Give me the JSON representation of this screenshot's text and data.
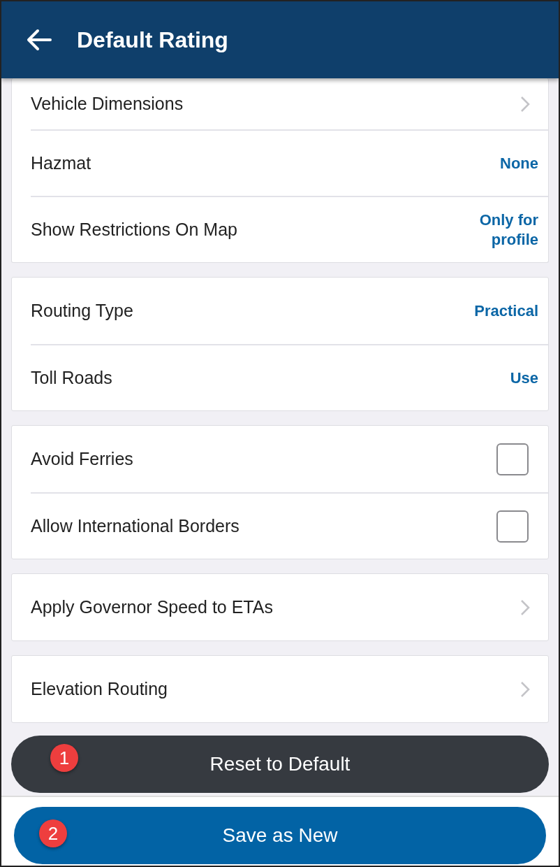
{
  "header": {
    "title": "Default Rating"
  },
  "sections": [
    {
      "rows": [
        {
          "kind": "nav",
          "label": "Vehicle Dimensions"
        },
        {
          "kind": "value",
          "label": "Hazmat",
          "value": "None"
        },
        {
          "kind": "value",
          "label": "Show Restrictions On Map",
          "value": "Only for profile"
        }
      ]
    },
    {
      "rows": [
        {
          "kind": "value",
          "label": "Routing Type",
          "value": "Practical"
        },
        {
          "kind": "value",
          "label": "Toll Roads",
          "value": "Use"
        }
      ]
    },
    {
      "rows": [
        {
          "kind": "checkbox",
          "label": "Avoid Ferries",
          "checked": false
        },
        {
          "kind": "checkbox",
          "label": "Allow International Borders",
          "checked": false
        }
      ]
    },
    {
      "rows": [
        {
          "kind": "nav",
          "label": "Apply Governor Speed to ETAs"
        }
      ]
    },
    {
      "rows": [
        {
          "kind": "nav",
          "label": "Elevation Routing"
        }
      ]
    }
  ],
  "buttons": [
    {
      "kind": "secondary",
      "label": "Reset to Default",
      "badge": "1"
    },
    {
      "kind": "primary",
      "label": "Save as New",
      "badge": "2"
    }
  ]
}
